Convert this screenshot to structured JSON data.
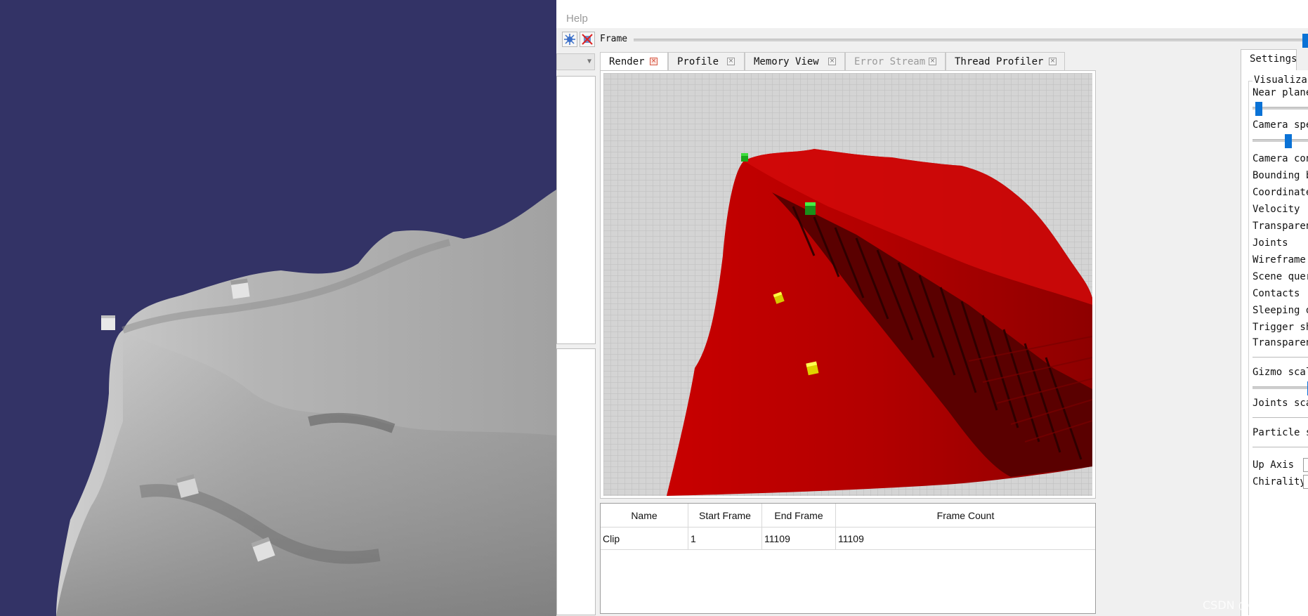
{
  "menubar": {
    "help_label": "Help"
  },
  "toolbar": {
    "frame_label": "Frame",
    "frame_slider_value": 1.0
  },
  "tabs": [
    {
      "label": "Render",
      "active": true
    },
    {
      "label": "Profile",
      "active": false
    },
    {
      "label": "Memory View",
      "active": false
    },
    {
      "label": "Error Stream",
      "active": false,
      "disabled": true
    },
    {
      "label": "Thread Profiler",
      "active": false
    }
  ],
  "clips": {
    "headers": [
      "Name",
      "Start Frame",
      "End Frame",
      "Frame Count"
    ],
    "rows": [
      [
        "Clip",
        "1",
        "11109",
        "11109"
      ]
    ]
  },
  "settings": {
    "tab_label": "Settings",
    "group_title": "Visualiza",
    "near_plane_label": "Near plane",
    "camera_speed_label": "Camera spe",
    "items": [
      "Camera con",
      "Bounding b",
      "Coordinate",
      "Velocity",
      "Transparen",
      "Joints",
      "Wireframe",
      "Scene quer",
      "Contacts",
      "Sleeping o",
      "Trigger sh",
      "Transparen"
    ],
    "gizmo_scale_label": "Gizmo scal",
    "joints_scale_label": "Joints sca",
    "particle_label": "Particle s",
    "up_axis_label": "Up Axis",
    "chirality_label": "Chirality"
  },
  "colors": {
    "viewport_bg": "#333366",
    "terrain_gray": "#a8a8a8",
    "terrain_red": "#b00000",
    "accent_blue": "#0a72d6"
  },
  "watermark": "CSDN @杨石兴"
}
